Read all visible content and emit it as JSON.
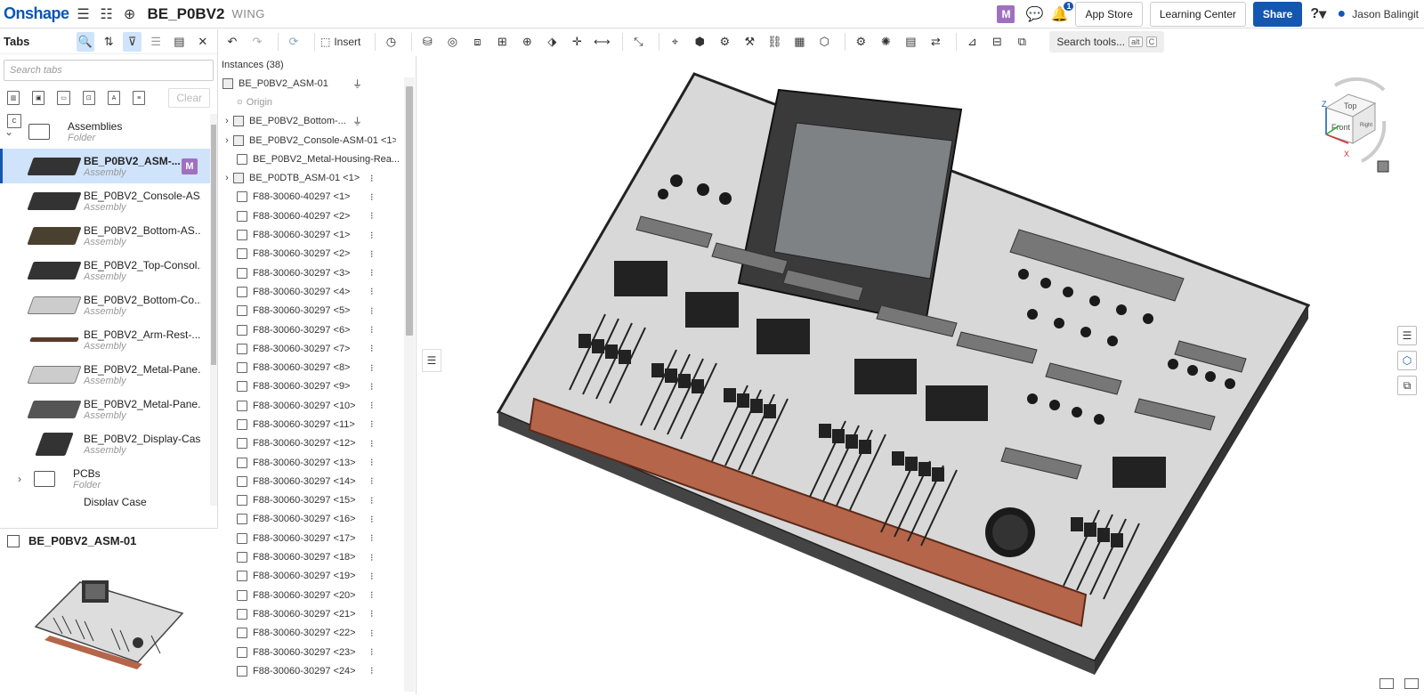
{
  "topbar": {
    "logo": "Onshape",
    "document_title": "BE_P0BV2",
    "workspace": "WING",
    "avatar_letter": "M",
    "notif_count": "1",
    "app_store": "App Store",
    "learning_center": "Learning Center",
    "share": "Share",
    "help": "?",
    "user_name": "Jason Balingit"
  },
  "toolbar": {
    "insert_label": "Insert",
    "search_tools": "Search tools...",
    "shortcut_alt": "alt",
    "shortcut_c": "C"
  },
  "tabs_panel": {
    "title": "Tabs",
    "search_placeholder": "Search tabs",
    "clear_label": "Clear",
    "items": [
      {
        "name": "Assemblies",
        "type": "Folder",
        "kind": "folder",
        "expanded": true
      },
      {
        "name": "BE_P0BV2_ASM-...",
        "type": "Assembly",
        "kind": "assembly",
        "selected": true,
        "badge": "M"
      },
      {
        "name": "BE_P0BV2_Console-AS...",
        "type": "Assembly",
        "kind": "assembly"
      },
      {
        "name": "BE_P0BV2_Bottom-AS...",
        "type": "Assembly",
        "kind": "assembly"
      },
      {
        "name": "BE_P0BV2_Top-Consol...",
        "type": "Assembly",
        "kind": "assembly"
      },
      {
        "name": "BE_P0BV2_Bottom-Co...",
        "type": "Assembly",
        "kind": "assembly"
      },
      {
        "name": "BE_P0BV2_Arm-Rest-...",
        "type": "Assembly",
        "kind": "assembly"
      },
      {
        "name": "BE_P0BV2_Metal-Pane...",
        "type": "Assembly",
        "kind": "assembly"
      },
      {
        "name": "BE_P0BV2_Metal-Pane...",
        "type": "Assembly",
        "kind": "assembly"
      },
      {
        "name": "BE_P0BV2_Display-Cas...",
        "type": "Assembly",
        "kind": "assembly"
      },
      {
        "name": "PCBs",
        "type": "Folder",
        "kind": "folder",
        "expanded": false
      },
      {
        "name": "Display Case",
        "type": "",
        "kind": "assembly"
      }
    ],
    "preview_title": "BE_P0BV2_ASM-01"
  },
  "instances": {
    "header": "Instances (38)",
    "root": "BE_P0BV2_ASM-01",
    "origin": "Origin",
    "rows": [
      {
        "name": "BE_P0BV2_Bottom-...",
        "chevron": true,
        "fixed": true
      },
      {
        "name": "BE_P0BV2_Console-ASM-01 <1>",
        "chevron": true
      },
      {
        "name": "BE_P0BV2_Metal-Housing-Rea...",
        "chevron": false
      },
      {
        "name": "BE_P0DTB_ASM-01 <1>",
        "chevron": true,
        "mate": true
      },
      {
        "name": "F88-30060-40297 <1>",
        "mate": true
      },
      {
        "name": "F88-30060-40297 <2>",
        "mate": true
      },
      {
        "name": "F88-30060-30297 <1>",
        "mate": true
      },
      {
        "name": "F88-30060-30297 <2>",
        "mate": true
      },
      {
        "name": "F88-30060-30297 <3>",
        "mate": true
      },
      {
        "name": "F88-30060-30297 <4>",
        "mate": true
      },
      {
        "name": "F88-30060-30297 <5>",
        "mate": true
      },
      {
        "name": "F88-30060-30297 <6>",
        "mate": true
      },
      {
        "name": "F88-30060-30297 <7>",
        "mate": true
      },
      {
        "name": "F88-30060-30297 <8>",
        "mate": true
      },
      {
        "name": "F88-30060-30297 <9>",
        "mate": true
      },
      {
        "name": "F88-30060-30297 <10>",
        "mate": true
      },
      {
        "name": "F88-30060-30297 <11>",
        "mate": true
      },
      {
        "name": "F88-30060-30297 <12>",
        "mate": true
      },
      {
        "name": "F88-30060-30297 <13>",
        "mate": true
      },
      {
        "name": "F88-30060-30297 <14>",
        "mate": true
      },
      {
        "name": "F88-30060-30297 <15>",
        "mate": true
      },
      {
        "name": "F88-30060-30297 <16>",
        "mate": true
      },
      {
        "name": "F88-30060-30297 <17>",
        "mate": true
      },
      {
        "name": "F88-30060-30297 <18>",
        "mate": true
      },
      {
        "name": "F88-30060-30297 <19>",
        "mate": true
      },
      {
        "name": "F88-30060-30297 <20>",
        "mate": true
      },
      {
        "name": "F88-30060-30297 <21>",
        "mate": true
      },
      {
        "name": "F88-30060-30297 <22>",
        "mate": true
      },
      {
        "name": "F88-30060-30297 <23>",
        "mate": true
      },
      {
        "name": "F88-30060-30297 <24>",
        "mate": true
      }
    ]
  },
  "viewcube": {
    "top": "Top",
    "front": "Front",
    "right": "Right",
    "axis_x": "X",
    "axis_z": "Z"
  },
  "colors": {
    "brand": "#0b56b3",
    "share": "#1357b0",
    "selection": "#cfe3fb",
    "avatar": "#a070c0",
    "armrest": "#b5654a"
  }
}
